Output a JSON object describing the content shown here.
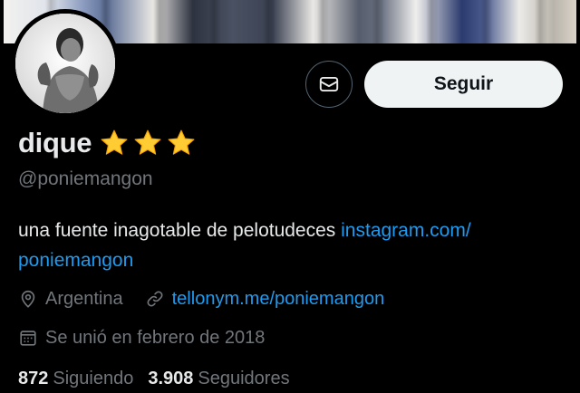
{
  "banner": {
    "alt": "header photo"
  },
  "profile": {
    "name": "dique",
    "badges": [
      "star-emoji",
      "star-emoji",
      "star-emoji"
    ],
    "handle": "@poniemangon",
    "bio_text": "una fuente inagotable de pelotudeces ",
    "bio_link_line1": "instagram.com/",
    "bio_link_line2": "poniemangon",
    "location": "Argentina",
    "website": "tellonym.me/poniemangon",
    "joined": "Se unió en febrero de 2018"
  },
  "actions": {
    "message_icon": "envelope-icon",
    "follow_label": "Seguir"
  },
  "stats": {
    "following_count": "872",
    "following_label": "Siguiendo",
    "followers_count": "3.908",
    "followers_label": "Seguidores"
  },
  "colors": {
    "background": "#000000",
    "text_primary": "#e7e9ea",
    "text_secondary": "#71767b",
    "link": "#1d9bf0",
    "follow_button_bg": "#eff3f4",
    "star": "#ffcc33"
  }
}
